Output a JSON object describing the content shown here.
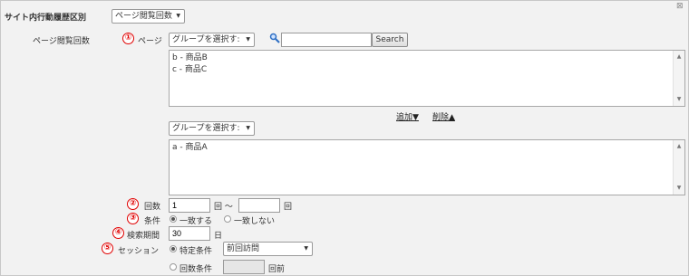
{
  "header": {
    "section_label": "サイト内行動履歴区別",
    "mode_select_value": "ページ閲覧回数",
    "close_glyph": "⊠"
  },
  "page_view": {
    "label": "ページ閲覧回数",
    "step1_number": "①",
    "page_label": "ページ",
    "group_select_value": "グループを選択す:",
    "search_placeholder": "",
    "search_button": "Search",
    "available_items": [
      "b - 商品B",
      "c - 商品C"
    ],
    "add_link": "追加▼",
    "remove_link": "削除▲",
    "group_select_value_2": "グループを選択す:",
    "selected_items": [
      "a - 商品A"
    ]
  },
  "count": {
    "step_number": "②",
    "label": "回数",
    "from_value": "1",
    "unit1": "回 〜",
    "to_value": "",
    "unit2": "回"
  },
  "condition": {
    "step_number": "③",
    "label": "条件",
    "option_match": "一致する",
    "option_nomatch": "一致しない",
    "selected": "match"
  },
  "period": {
    "step_number": "④",
    "label": "検索期間",
    "value": "30",
    "unit": "日"
  },
  "session": {
    "step_number": "⑤",
    "label": "セッション",
    "option_specific": "特定条件",
    "specific_select_value": "前回訪問",
    "option_count": "回数条件",
    "count_value": "",
    "count_unit": "回前",
    "selected": "specific"
  },
  "colors": {
    "accent_red": "#e00000",
    "panel_bg": "#f2f2f2"
  }
}
